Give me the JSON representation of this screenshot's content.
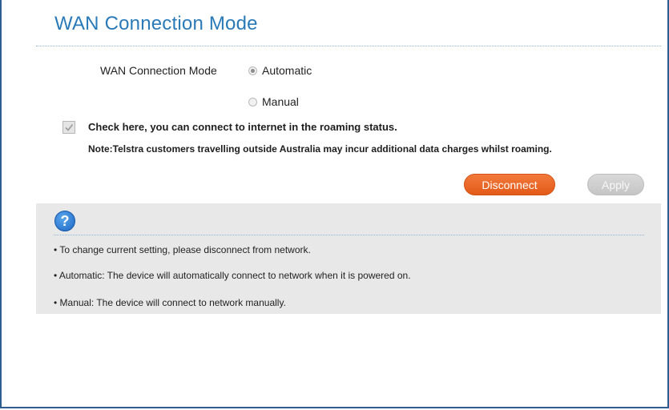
{
  "page": {
    "title": "WAN Connection Mode"
  },
  "form": {
    "mode_label": "WAN Connection Mode",
    "options": [
      {
        "label": "Automatic",
        "selected": true
      },
      {
        "label": "Manual",
        "selected": false
      }
    ],
    "roaming_checkbox": {
      "checked": true,
      "label": "Check here, you can connect to internet in the roaming status."
    },
    "note": "Note:Telstra customers travelling outside Australia may incur additional data charges whilst roaming."
  },
  "buttons": {
    "disconnect": "Disconnect",
    "apply": "Apply"
  },
  "help": {
    "icon": "help-question-icon",
    "symbol": "?",
    "lines": [
      "• To change current setting, please disconnect from network.",
      "• Automatic: The device will automatically connect to network when it is powered on.",
      "• Manual: The device will connect to network manually."
    ]
  },
  "colors": {
    "title": "#2a7ab8",
    "disconnect_button": "#e8621f",
    "apply_button_disabled": "#cfcfcf",
    "help_panel_bg": "#e8e8e8",
    "frame_border": "#2f5d8f"
  }
}
